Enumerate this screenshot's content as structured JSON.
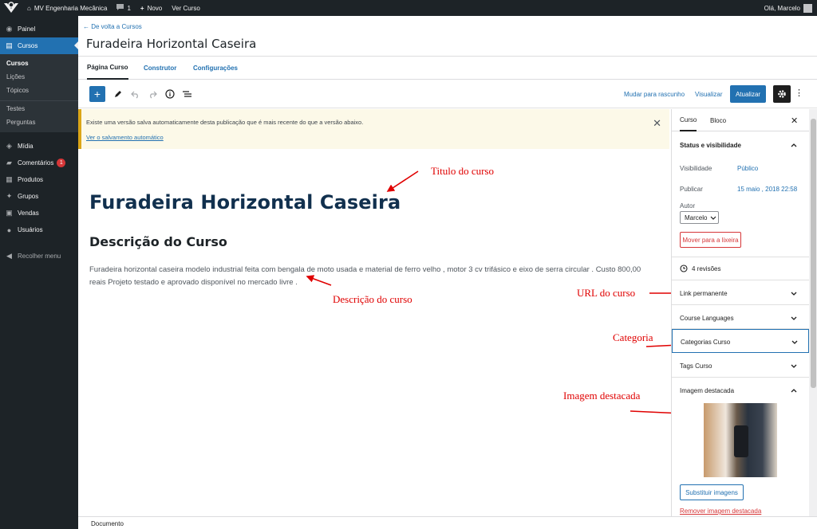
{
  "admin_bar": {
    "site_name": "MV Engenharia Mecânica",
    "comments_count": "1",
    "new_label": "Novo",
    "view_label": "Ver Curso",
    "greeting": "Olá, Marcelo"
  },
  "sidebar": {
    "items": [
      {
        "label": "Painel",
        "icon": "dashboard-icon"
      },
      {
        "label": "Cursos",
        "icon": "courses-icon"
      },
      {
        "label": "Mídia",
        "icon": "media-icon"
      },
      {
        "label": "Comentários",
        "icon": "comments-icon",
        "badge": "1"
      },
      {
        "label": "Produtos",
        "icon": "products-icon"
      },
      {
        "label": "Grupos",
        "icon": "groups-icon"
      },
      {
        "label": "Vendas",
        "icon": "sales-icon"
      },
      {
        "label": "Usuários",
        "icon": "users-icon"
      }
    ],
    "submenu": [
      "Cursos",
      "Lições",
      "Tópicos",
      "Testes",
      "Perguntas"
    ],
    "collapse_label": "Recolher menu"
  },
  "header": {
    "back_link": "← De volta a Cursos",
    "title": "Furadeira Horizontal Caseira",
    "tabs": [
      "Página Curso",
      "Construtor",
      "Configurações"
    ]
  },
  "toolbar": {
    "draft_label": "Mudar para rascunho",
    "preview_label": "Visualizar",
    "update_label": "Atualizar"
  },
  "notice": {
    "text": "Existe uma versão salva automaticamente desta publicação que é mais recente do que a versão abaixo.",
    "link": "Ver o salvamento automático"
  },
  "content": {
    "post_title": "Furadeira Horizontal Caseira",
    "heading": "Descrição do Curso",
    "paragraph": "Furadeira horizontal caseira modelo industrial feita com bengala de moto usada e material de ferro velho , motor 3 cv trifásico e eixo de serra circular . Custo 800,00 reais Projeto testado e aprovado disponível no mercado livre ."
  },
  "annotations": {
    "title": "Titulo do curso",
    "description": "Descrição do curso",
    "url": "URL do curso",
    "category": "Categoria",
    "image": "Imagem destacada"
  },
  "panel": {
    "tabs": [
      "Curso",
      "Bloco"
    ],
    "status_title": "Status e visibilidade",
    "visibility_label": "Visibilidade",
    "visibility_value": "Público",
    "publish_label": "Publicar",
    "publish_value": "15 maio , 2018 22:58",
    "author_label": "Autor",
    "author_value": "Marcelo",
    "trash_label": "Mover para a lixeira",
    "revisions": "4 revisões",
    "permalink": "Link permanente",
    "languages": "Course Languages",
    "categories": "Categorias Curso",
    "tags": "Tags Curso",
    "featured_title": "Imagem destacada",
    "replace_label": "Substituir imagens",
    "remove_label": "Remover imagem destacada"
  },
  "footer": {
    "breadcrumb": "Documento"
  },
  "colors": {
    "accent": "#2271b1",
    "admin_dark": "#1d2327",
    "annotation_red": "#e00000",
    "notice_bg": "#fcf9e8"
  }
}
